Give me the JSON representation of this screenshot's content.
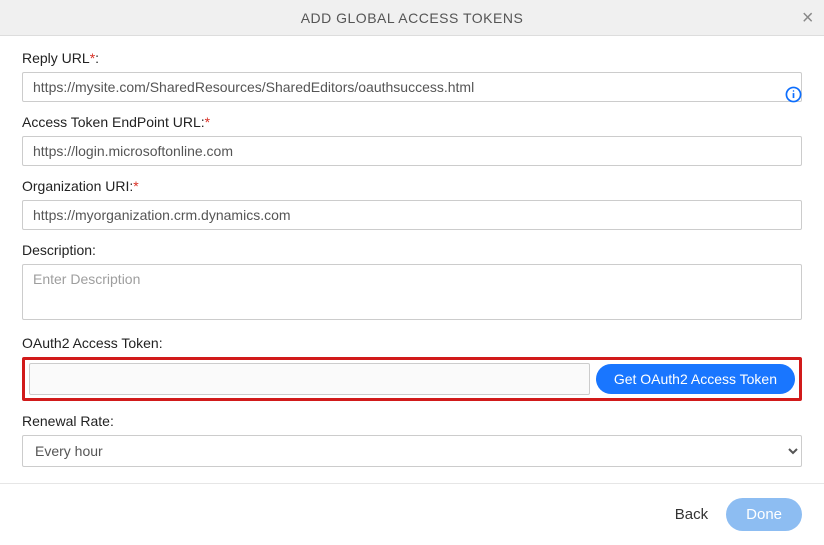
{
  "header": {
    "title": "ADD GLOBAL ACCESS TOKENS"
  },
  "fields": {
    "reply_url": {
      "label": "Reply URL",
      "value": "https://mysite.com/SharedResources/SharedEditors/oauthsuccess.html"
    },
    "endpoint_url": {
      "label": "Access Token EndPoint URL:",
      "value": "https://login.microsoftonline.com"
    },
    "org_uri": {
      "label": "Organization URI:",
      "value": "https://myorganization.crm.dynamics.com"
    },
    "description": {
      "label": "Description:",
      "placeholder": "Enter Description",
      "value": ""
    },
    "oauth_token": {
      "label": "OAuth2 Access Token:",
      "button": "Get OAuth2 Access Token"
    },
    "renewal_rate": {
      "label": "Renewal Rate:",
      "value": "Every hour"
    }
  },
  "footer": {
    "back": "Back",
    "done": "Done"
  }
}
